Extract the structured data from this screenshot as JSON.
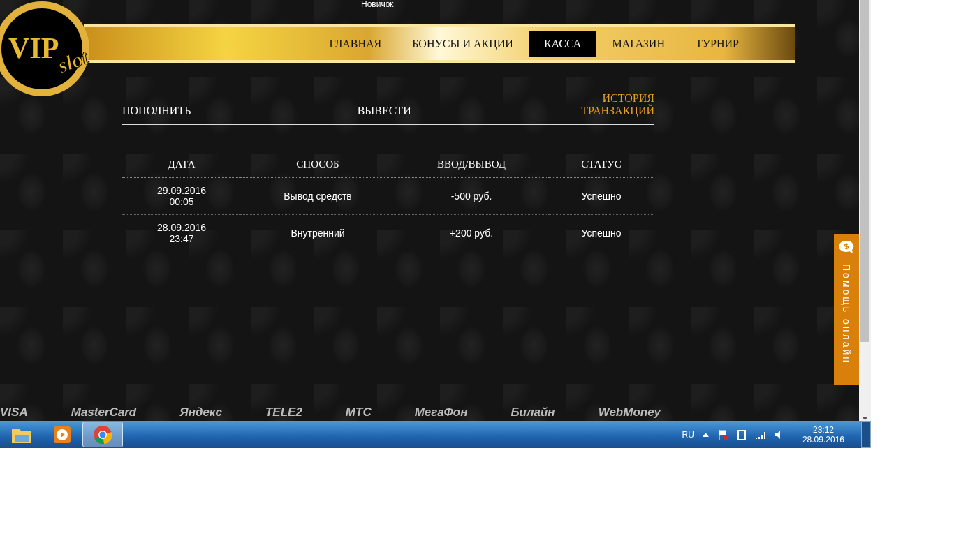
{
  "user_bar": {
    "rank": "Новичок"
  },
  "logo": {
    "main": "VIP",
    "script": "slot"
  },
  "nav": [
    {
      "label": "ГЛАВНАЯ",
      "selected": false
    },
    {
      "label": "БОНУСЫ И АКЦИИ",
      "selected": false
    },
    {
      "label": "КАССА",
      "selected": true
    },
    {
      "label": "МАГАЗИН",
      "selected": false
    },
    {
      "label": "ТУРНИР",
      "selected": false
    }
  ],
  "cashier_tabs": [
    {
      "label": "ПОПОЛНИТЬ",
      "selected": false
    },
    {
      "label": "ВЫВЕСТИ",
      "selected": false
    },
    {
      "label": "ИСТОРИЯ ТРАНЗАКЦИЙ",
      "selected": true
    }
  ],
  "table": {
    "columns": [
      "ДАТА",
      "СПОСОБ",
      "ВВОД/ВЫВОД",
      "СТАТУС"
    ],
    "rows": [
      {
        "date": "29.09.2016",
        "time": "00:05",
        "method": "Вывод средств",
        "amount": "-500 руб.",
        "status": "Успешно"
      },
      {
        "date": "28.09.2016",
        "time": "23:47",
        "method": "Внутренний",
        "amount": "+200 руб.",
        "status": "Успешно"
      }
    ]
  },
  "payment_logos": [
    "VISA",
    "MasterCard",
    "Яндекс",
    "TELE2",
    "МТС",
    "МегаФон",
    "Билайн",
    "WebMoney"
  ],
  "help_tab": {
    "label": "Помощь онлайн"
  },
  "taskbar": {
    "apps": [
      {
        "kind": "folder",
        "selected": false
      },
      {
        "kind": "player",
        "selected": false
      },
      {
        "kind": "browser",
        "selected": true
      }
    ],
    "language": "RU",
    "time": "23:12",
    "date": "28.09.2016"
  }
}
